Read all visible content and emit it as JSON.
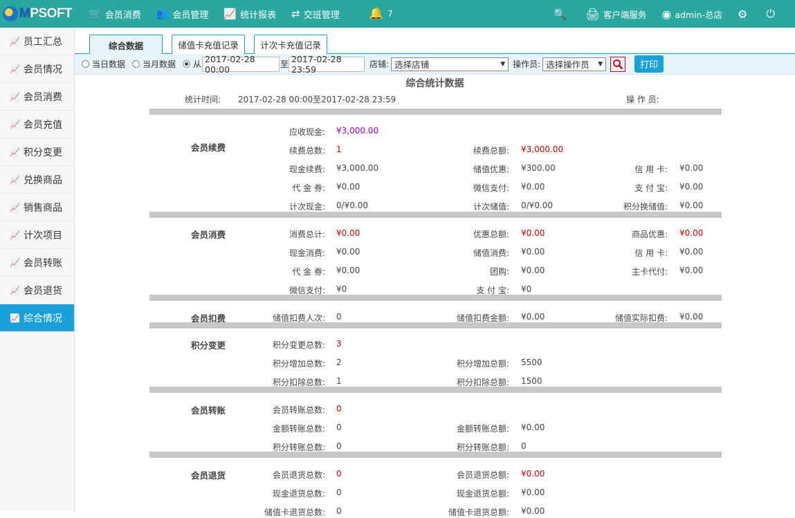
{
  "brand": {
    "name_prefix": "M",
    "name": "PSOFT"
  },
  "nav": [
    {
      "icon": "cart-icon",
      "label": "会员消费"
    },
    {
      "icon": "users-icon",
      "label": "会员管理"
    },
    {
      "icon": "chart-icon",
      "label": "统计报表"
    },
    {
      "icon": "exchange-icon",
      "label": "交班管理"
    }
  ],
  "bell": {
    "count": "7"
  },
  "tools": {
    "service": "客户端服务",
    "user": "admin-总店"
  },
  "sidebar": [
    "员工汇总",
    "会员情况",
    "会员消费",
    "会员充值",
    "积分变更",
    "兑换商品",
    "销售商品",
    "计次项目",
    "会员转账",
    "会员退货",
    "综合情况"
  ],
  "tabs": [
    "综合数据",
    "储值卡充值记录",
    "计次卡充值记录"
  ],
  "filter": {
    "today": "当日数据",
    "month": "当月数据",
    "from": "从",
    "start": "2017-02-28 00:00",
    "to": "至",
    "end": "2017-02-28 23:59",
    "store_label": "店铺:",
    "store_value": "选择店铺",
    "operator_label": "操作员:",
    "operator_value": "选择操作员",
    "print": "打印"
  },
  "report": {
    "title": "综合统计数据",
    "time_label": "统计时间:",
    "time_value": "2017-02-28 00:00至2017-02-28 23:59",
    "operator_label": "操 作 员:",
    "sections": {
      "renew": {
        "name": "会员续费",
        "rows": [
          [
            [
              "应收现金:",
              "¥3,000.00",
              "purple"
            ]
          ],
          [
            [
              "续费总数:",
              "1",
              "red"
            ],
            [
              "续费总额:",
              "¥3,000.00",
              "red"
            ]
          ],
          [
            [
              "现金续费:",
              "¥3,000.00",
              ""
            ],
            [
              "储值优惠:",
              "¥300.00",
              ""
            ],
            [
              "信 用 卡:",
              "¥0.00",
              ""
            ]
          ],
          [
            [
              "代 金 券:",
              "¥0.00",
              ""
            ],
            [
              "微信支付:",
              "¥0.00",
              ""
            ],
            [
              "支 付 宝:",
              "¥0.00",
              ""
            ]
          ],
          [
            [
              "计次现金:",
              "0/¥0.00",
              ""
            ],
            [
              "计次储值:",
              "0/¥0.00",
              ""
            ],
            [
              "积分换储值:",
              "¥0.00",
              ""
            ]
          ]
        ]
      },
      "consume": {
        "name": "会员消费",
        "rows": [
          [
            [
              "消费总计:",
              "¥0.00",
              "red"
            ],
            [
              "优惠总额:",
              "¥0.00",
              "red"
            ],
            [
              "商品优惠:",
              "¥0.00",
              "red"
            ]
          ],
          [
            [
              "现金消费:",
              "¥0.00",
              ""
            ],
            [
              "储值消费:",
              "¥0.00",
              ""
            ],
            [
              "信 用 卡:",
              "¥0.00",
              ""
            ]
          ],
          [
            [
              "代 金 券:",
              "¥0.00",
              ""
            ],
            [
              "团购:",
              "¥0.00",
              ""
            ],
            [
              "主卡代付:",
              "¥0.00",
              ""
            ]
          ],
          [
            [
              "微信支付:",
              "¥0",
              ""
            ],
            [
              "支 付 宝:",
              "¥0",
              ""
            ]
          ]
        ]
      },
      "deduct": {
        "name": "会员扣费",
        "rows": [
          [
            [
              "储值扣费人次:",
              "0",
              ""
            ],
            [
              "储值扣费金额:",
              "¥0.00",
              ""
            ],
            [
              "储值实际扣费:",
              "¥0.00",
              ""
            ]
          ]
        ]
      },
      "points": {
        "name": "积分变更",
        "rows": [
          [
            [
              "积分变更总数:",
              "3",
              "red"
            ]
          ],
          [
            [
              "积分增加总数:",
              "2",
              ""
            ],
            [
              "积分增加总额:",
              "5500",
              ""
            ]
          ],
          [
            [
              "积分扣除总数:",
              "1",
              ""
            ],
            [
              "积分扣除总额:",
              "1500",
              ""
            ]
          ]
        ]
      },
      "transfer": {
        "name": "会员转账",
        "rows": [
          [
            [
              "会员转账总数:",
              "0",
              "red"
            ]
          ],
          [
            [
              "金额转账总数:",
              "0",
              ""
            ],
            [
              "金额转账总额:",
              "¥0.00",
              ""
            ]
          ],
          [
            [
              "积分转账总数:",
              "0",
              ""
            ],
            [
              "积分转账总额:",
              "0",
              ""
            ]
          ]
        ]
      },
      "refund": {
        "name": "会员退货",
        "rows": [
          [
            [
              "会员退货总数:",
              "0",
              "red"
            ],
            [
              "会员退货总额:",
              "¥0.00",
              "red"
            ]
          ],
          [
            [
              "现金退货总数:",
              "0",
              ""
            ],
            [
              "现金退货总额:",
              "¥0.00",
              ""
            ]
          ],
          [
            [
              "储值卡退货总数:",
              "0",
              ""
            ],
            [
              "储值卡退货总额:",
              "¥0.00",
              ""
            ]
          ]
        ]
      }
    }
  }
}
